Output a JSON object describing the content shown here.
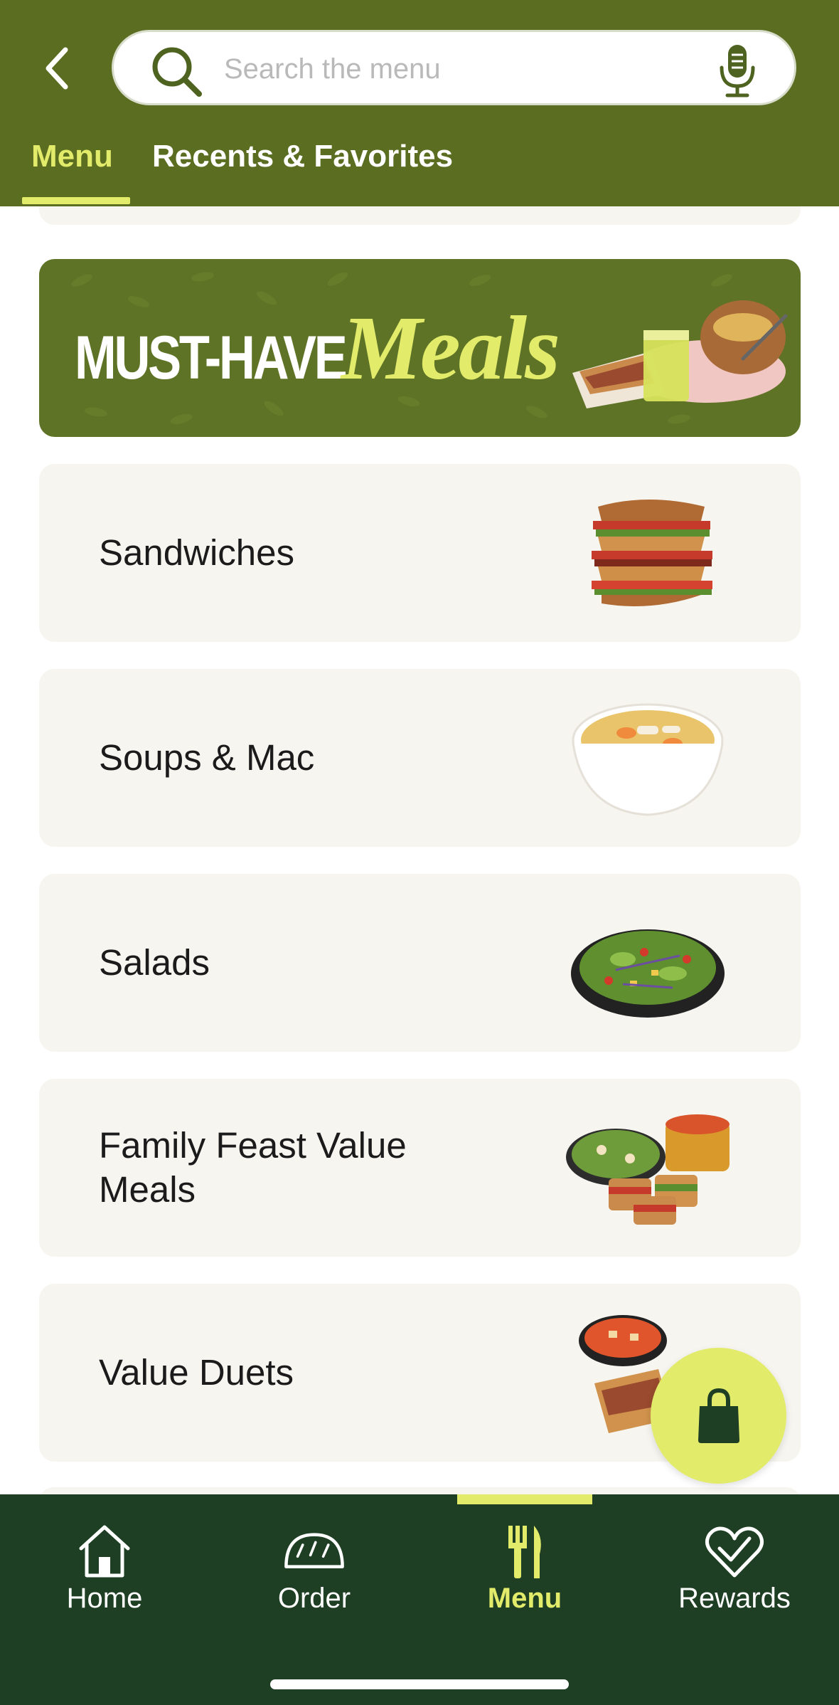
{
  "colors": {
    "brand_green": "#5a6d21",
    "accent_lime": "#e2ec6a",
    "nav_dark_green": "#1e3f24",
    "card_bg": "#f7f5f0"
  },
  "header": {
    "back_icon": "chevron-left-icon",
    "search": {
      "placeholder": "Search the menu",
      "value": "",
      "search_icon": "search-icon",
      "mic_icon": "microphone-icon"
    },
    "tabs": [
      {
        "label": "Menu",
        "active": true
      },
      {
        "label": "Recents & Favorites",
        "active": false
      }
    ]
  },
  "promo": {
    "text_a": "MUST-HAVE",
    "text_b": "Meals"
  },
  "categories": [
    {
      "label": "Sandwiches",
      "icon": "sandwich-image"
    },
    {
      "label": "Soups & Mac",
      "icon": "soup-bowl-image"
    },
    {
      "label": "Salads",
      "icon": "salad-image"
    },
    {
      "label": "Family Feast Value Meals",
      "icon": "family-feast-image"
    },
    {
      "label": "Value Duets",
      "icon": "value-duet-image"
    }
  ],
  "cart_icon": "shopping-bag-icon",
  "bottom_nav": [
    {
      "label": "Home",
      "icon": "home-icon",
      "active": false
    },
    {
      "label": "Order",
      "icon": "bread-icon",
      "active": false
    },
    {
      "label": "Menu",
      "icon": "fork-knife-icon",
      "active": true
    },
    {
      "label": "Rewards",
      "icon": "heart-icon",
      "active": false
    }
  ]
}
